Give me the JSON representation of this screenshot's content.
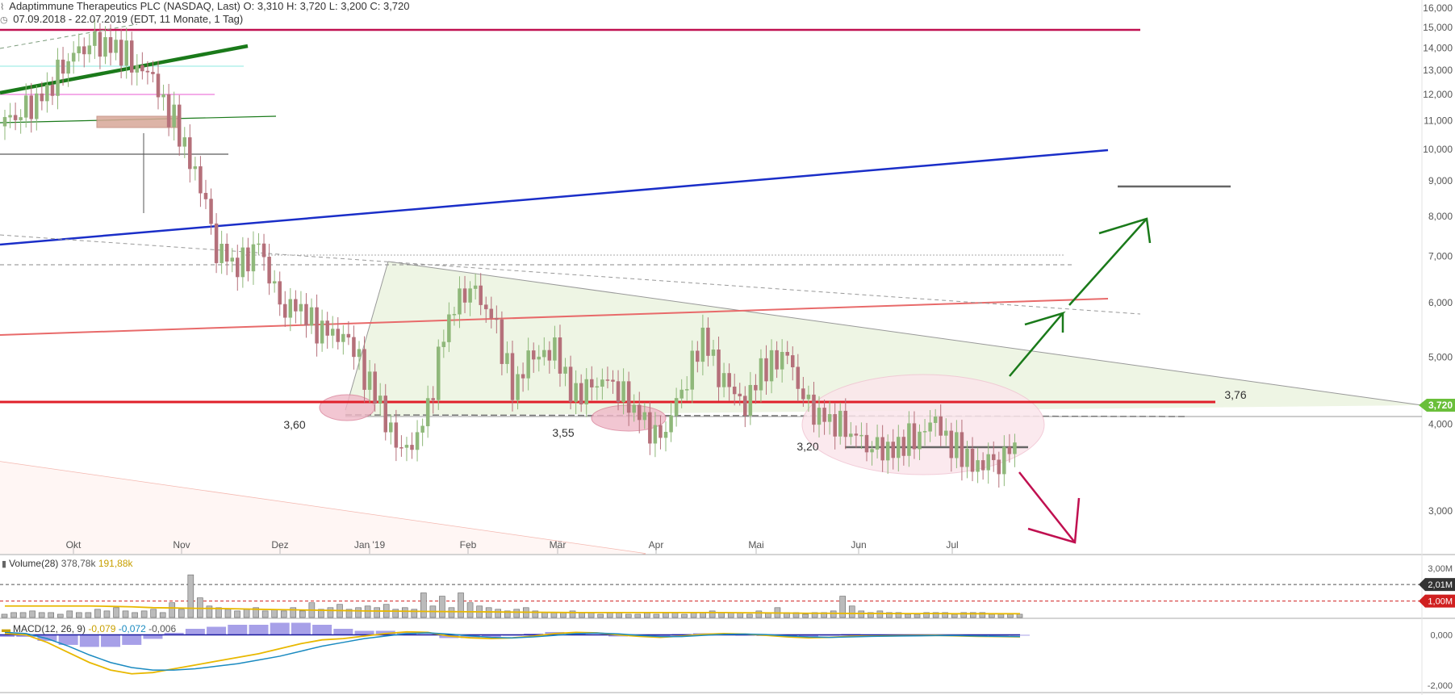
{
  "header": {
    "title": "Adaptimmune Therapeutics PLC (NASDAQ, Last)",
    "ohlc": "O: 3,310  H: 3,720  L: 3,200  C: 3,720",
    "range": "07.09.2018 - 22.07.2019",
    "range_detail": "(EDT, 11 Monate, 1 Tag)"
  },
  "colors": {
    "up": "#8fb87a",
    "down": "#b5707a",
    "support": "#e0202a",
    "resistance": "#c01050",
    "blue_trend": "#1a2ec8",
    "green_trend": "#1a7a1a",
    "triangle_fill": "#eef5e4",
    "last_price": "#6abf3a"
  },
  "chart_data": [
    {
      "type": "line",
      "name": "price",
      "x_labels": [
        "Okt",
        "Nov",
        "Dez",
        "Jan '19",
        "Feb",
        "Mär",
        "Apr",
        "Mai",
        "Jun",
        "Jul"
      ],
      "ylim": [
        2.6,
        16.0
      ],
      "y_scale": "log",
      "y_ticks": [
        "16,000",
        "15,000",
        "14,000",
        "13,000",
        "12,000",
        "11,000",
        "10,000",
        "9,000",
        "8,000",
        "7,000",
        "6,000",
        "5,000",
        "4,000",
        "3,000"
      ],
      "y_tick_values": [
        16,
        15,
        14,
        13,
        12,
        11,
        10,
        9,
        8,
        7,
        6,
        5,
        4,
        3
      ],
      "series": [
        {
          "values": [
            10.8,
            11.6,
            12.3,
            13.2,
            14.2,
            14.6,
            13.3,
            12.2,
            11.0,
            9.6,
            7.1,
            6.6,
            7.4,
            6.0,
            5.7,
            5.4,
            5.6,
            4.8,
            3.9,
            3.6,
            4.3,
            5.7,
            6.2,
            5.9,
            4.6,
            4.9,
            5.0,
            4.5,
            4.7,
            4.4,
            4.1,
            3.9,
            4.4,
            5.2,
            4.7,
            4.4,
            4.8,
            4.9,
            4.3,
            4.1,
            3.8,
            3.7,
            3.8,
            3.8,
            3.9,
            3.7,
            3.6,
            3.5,
            3.7
          ]
        }
      ],
      "annotations": {
        "level_labels": [
          "3,60",
          "3,55",
          "3,20",
          "3,76"
        ],
        "last_price": "3,720"
      }
    },
    {
      "type": "bar",
      "name": "Volume(28)",
      "legend": "Volume(28)",
      "legend_values": [
        "378,78k",
        "191,88k"
      ],
      "y_ticks": [
        "3,00M",
        "2,01M",
        "1,00M"
      ],
      "y_tick_values": [
        3.0,
        2.01,
        1.0
      ],
      "ylim": [
        0,
        3.0
      ],
      "values": [
        0.2,
        0.3,
        0.3,
        0.4,
        0.3,
        0.3,
        0.2,
        0.4,
        0.3,
        0.3,
        0.5,
        0.4,
        0.6,
        0.4,
        0.3,
        0.4,
        0.5,
        0.3,
        0.9,
        0.5,
        2.6,
        1.2,
        0.7,
        0.6,
        0.5,
        0.4,
        0.5,
        0.6,
        0.4,
        0.5,
        0.4,
        0.6,
        0.4,
        0.9,
        0.5,
        0.6,
        0.8,
        0.5,
        0.6,
        0.7,
        0.6,
        0.8,
        0.5,
        0.6,
        0.5,
        1.5,
        0.7,
        1.3,
        0.6,
        1.5,
        0.9,
        0.7,
        0.6,
        0.5,
        0.4,
        0.5,
        0.6,
        0.4,
        0.3,
        0.3,
        0.3,
        0.4,
        0.3,
        0.3,
        0.2,
        0.3,
        0.3,
        0.2,
        0.2,
        0.3,
        0.2,
        0.3,
        0.3,
        0.2,
        0.3,
        0.3,
        0.4,
        0.3,
        0.3,
        0.3,
        0.2,
        0.4,
        0.3,
        0.6,
        0.3,
        0.3,
        0.2,
        0.3,
        0.3,
        0.4,
        1.3,
        0.7,
        0.4,
        0.3,
        0.4,
        0.3,
        0.3,
        0.2,
        0.2,
        0.3,
        0.3,
        0.3,
        0.2,
        0.3,
        0.3,
        0.3,
        0.2,
        0.2,
        0.2,
        0.2
      ],
      "average": [
        0.7,
        0.7,
        0.7,
        0.7,
        0.7,
        0.68,
        0.65,
        0.6,
        0.58,
        0.56,
        0.55,
        0.53,
        0.5,
        0.48,
        0.46,
        0.44,
        0.42,
        0.4,
        0.39,
        0.38,
        0.37,
        0.36,
        0.35,
        0.34,
        0.33,
        0.32,
        0.31,
        0.3,
        0.3,
        0.3,
        0.3,
        0.3,
        0.3,
        0.3,
        0.3,
        0.29,
        0.28,
        0.27,
        0.26,
        0.26,
        0.25,
        0.25,
        0.24,
        0.24,
        0.24,
        0.23,
        0.23,
        0.23,
        0.23
      ]
    },
    {
      "type": "line",
      "name": "MACD(12, 26, 9)",
      "legend": "MACD(12, 26, 9)",
      "legend_values": [
        "-0,079",
        "-0,072",
        "-0,006"
      ],
      "y_ticks": [
        "0,000",
        "-2,000"
      ],
      "y_tick_values": [
        0,
        -2
      ],
      "ylim": [
        -2.2,
        0.4
      ],
      "series": [
        {
          "name": "macd",
          "values": [
            0.05,
            0.0,
            -0.3,
            -0.7,
            -1.1,
            -1.4,
            -1.55,
            -1.5,
            -1.35,
            -1.2,
            -1.05,
            -0.9,
            -0.75,
            -0.55,
            -0.35,
            -0.2,
            -0.15,
            -0.05,
            0.05,
            0.12,
            0.1,
            -0.05,
            -0.12,
            -0.15,
            -0.12,
            -0.05,
            0.05,
            0.1,
            0.08,
            0.0,
            -0.06,
            -0.1,
            -0.05,
            0.02,
            0.05,
            0.03,
            -0.02,
            -0.08,
            -0.12,
            -0.1,
            -0.06,
            -0.05,
            -0.04,
            -0.03,
            -0.02,
            -0.04,
            -0.06,
            -0.07,
            -0.08
          ]
        },
        {
          "name": "signal",
          "values": [
            0.1,
            0.05,
            -0.15,
            -0.45,
            -0.8,
            -1.1,
            -1.3,
            -1.4,
            -1.4,
            -1.35,
            -1.25,
            -1.15,
            -1.0,
            -0.85,
            -0.65,
            -0.45,
            -0.3,
            -0.15,
            -0.05,
            0.05,
            0.08,
            0.03,
            -0.04,
            -0.1,
            -0.12,
            -0.08,
            -0.02,
            0.05,
            0.07,
            0.04,
            -0.02,
            -0.07,
            -0.07,
            -0.02,
            0.02,
            0.03,
            0.01,
            -0.04,
            -0.08,
            -0.1,
            -0.08,
            -0.06,
            -0.05,
            -0.04,
            -0.03,
            -0.03,
            -0.05,
            -0.06,
            -0.07
          ]
        }
      ]
    }
  ]
}
